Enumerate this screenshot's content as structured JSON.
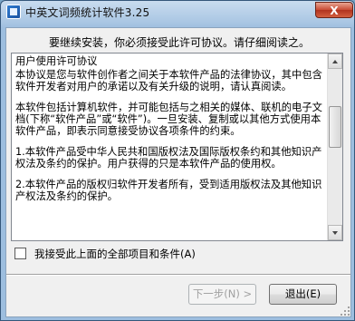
{
  "window": {
    "title": "中英文词频统计软件3.25",
    "close_label": "X"
  },
  "prompt": "要继续安装，你必须接受此许可协议。请仔细阅读之。",
  "license_paragraphs": [
    "用户使用许可协议",
    "本协议是您与软件创作者之间关于本软件产品的法律协议，其中包含软件开发者对用户的承诺以及有关升级的说明，请认真阅读。",
    "本软件包括计算机软件，并可能包括与之相关的媒体、联机的电子文档(下称“软件产品”或“软件”)。一旦安装、复制或以其他方式使用本软件产品，即表示同意接受协议各项条件的约束。",
    "1.本软件产品受中华人民共和国版权法及国际版权条约和其他知识产权法及条约的保护。用户获得的只是本软件产品的使用权。",
    "2.本软件产品的版权归软件开发者所有，受到适用版权法及其他知识产权法及条约的保护。"
  ],
  "accept_checkbox": {
    "label": "我接受此上面的全部项目和条件(A)",
    "checked": false
  },
  "buttons": {
    "next": "下一步(N) >",
    "exit": "退出(E)"
  }
}
